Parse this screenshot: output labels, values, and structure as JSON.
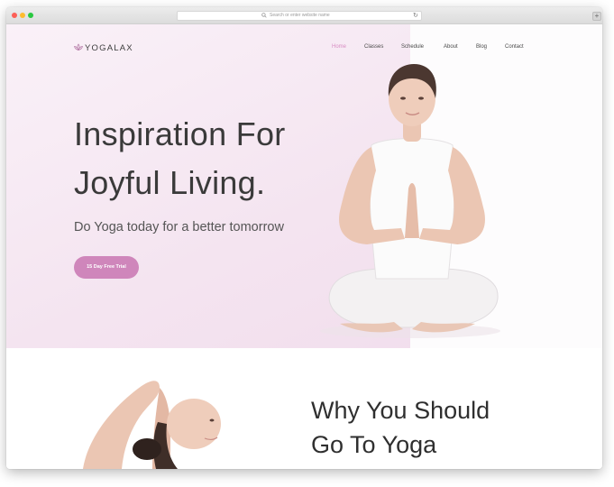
{
  "browser": {
    "url_placeholder": "Search or enter website name",
    "reload_icon": "reload-icon",
    "new_tab_label": "+"
  },
  "site": {
    "brand": "YOGALAX",
    "nav": [
      "Home",
      "Classes",
      "Schedule",
      "About",
      "Blog",
      "Contact"
    ],
    "active_nav": "Home"
  },
  "hero": {
    "headline_line1": "Inspiration For",
    "headline_line2": "Joyful Living.",
    "subtitle": "Do Yoga today for a better tomorrow",
    "cta_label": "15 Day Free Trial"
  },
  "section": {
    "title_line1": "Why You Should",
    "title_line2": "Go To Yoga"
  },
  "colors": {
    "accent": "#cf86bb",
    "nav_active": "#d88cc3",
    "hero_bg": "#f4e4f0",
    "text_dark": "#3a3a3a"
  }
}
